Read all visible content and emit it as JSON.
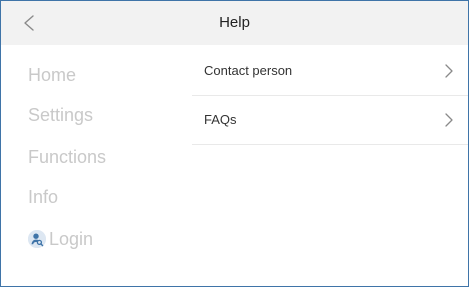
{
  "header": {
    "back_icon": "chevron-left-icon",
    "title": "Help"
  },
  "sidebar": {
    "items": [
      {
        "label": "Home"
      },
      {
        "label": "Settings"
      },
      {
        "label": "Functions"
      },
      {
        "label": "Info"
      },
      {
        "label": "Login",
        "icon": "user-search-icon"
      }
    ]
  },
  "help_menu": {
    "items": [
      {
        "label": "Contact person",
        "icon": "chevron-right-icon"
      },
      {
        "label": "FAQs",
        "icon": "chevron-right-icon"
      }
    ]
  },
  "colors": {
    "accent": "#3f74a8",
    "header_bg": "#f2f2f2",
    "sidebar_text": "#c9c9c9"
  }
}
